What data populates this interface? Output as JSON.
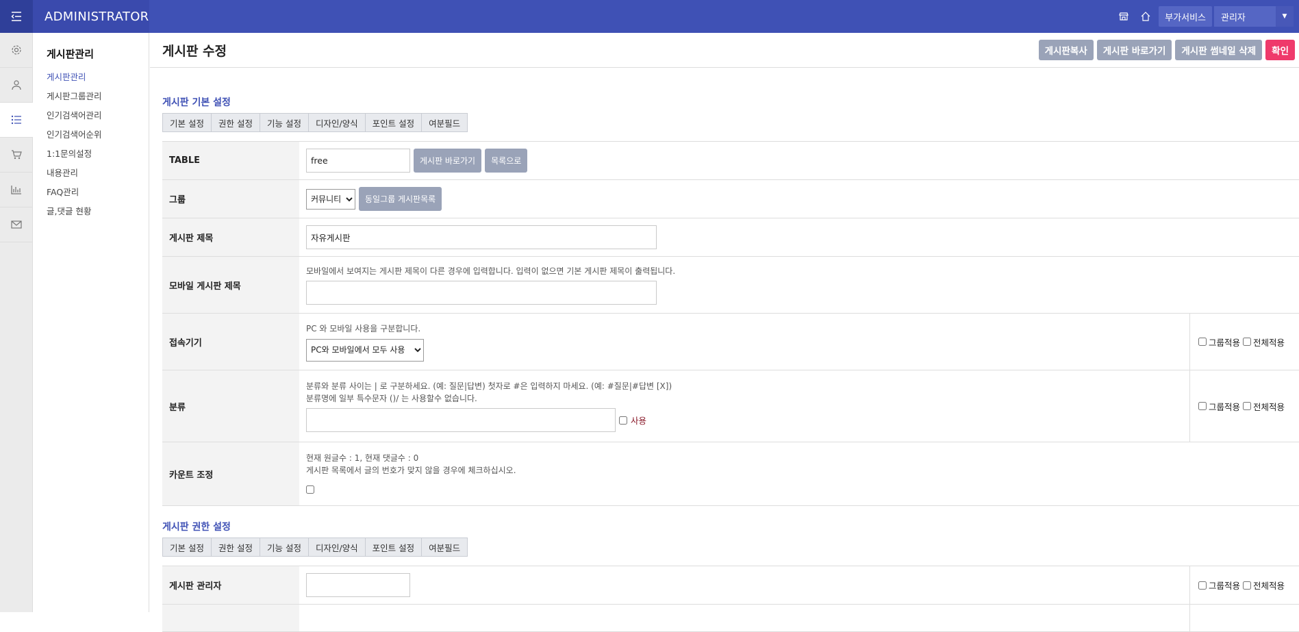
{
  "topbar": {
    "brand": "ADMINISTRATOR",
    "addon_label": "부가서비스",
    "admin_label": "관리자"
  },
  "subnav": {
    "title": "게시판관리",
    "items": [
      {
        "label": "게시판관리"
      },
      {
        "label": "게시판그룹관리"
      },
      {
        "label": "인기검색어관리"
      },
      {
        "label": "인기검색어순위"
      },
      {
        "label": "1:1문의설정"
      },
      {
        "label": "내용관리"
      },
      {
        "label": "FAQ관리"
      },
      {
        "label": "글,댓글 현황"
      }
    ]
  },
  "page": {
    "title": "게시판 수정",
    "buttons": {
      "copy": "게시판복사",
      "go": "게시판 바로가기",
      "thumb_delete": "게시판 썸네일 삭제",
      "confirm": "확인"
    }
  },
  "tabs": [
    "기본 설정",
    "권한 설정",
    "기능 설정",
    "디자인/양식",
    "포인트 설정",
    "여분필드"
  ],
  "basic": {
    "title": "게시판 기본 설정",
    "table_label": "TABLE",
    "table_value": "free",
    "table_go": "게시판 바로가기",
    "table_list": "목록으로",
    "group_label": "그룹",
    "group_value": "커뮤니티",
    "group_btn": "동일그룹 게시판목록",
    "subject_label": "게시판 제목",
    "subject_value": "자유게시판",
    "mobile_label": "모바일 게시판 제목",
    "mobile_help": "모바일에서 보여지는 게시판 제목이 다른 경우에 입력합니다. 입력이 없으면 기본 게시판 제목이 출력됩니다.",
    "device_label": "접속기기",
    "device_help": "PC 와 모바일 사용을 구분합니다.",
    "device_value": "PC와 모바일에서 모두 사용",
    "category_label": "분류",
    "category_help1": "분류와 분류 사이는 | 로 구분하세요. (예: 질문|답변) 첫자로 #은 입력하지 마세요. (예: #질문|#답변 [X])",
    "category_help2": "분류명에 일부 특수문자 ()/ 는 사용할수 없습니다.",
    "category_use": "사용",
    "count_label": "카운트 조정",
    "count_help1": "현재 원글수 : 1, 현재 댓글수 : 0",
    "count_help2": "게시판 목록에서 글의 번호가 맞지 않을 경우에 체크하십시오."
  },
  "perm": {
    "title": "게시판 권한 설정",
    "admin_label": "게시판 관리자"
  },
  "side": {
    "group_apply": "그룹적용",
    "all_apply": "전체적용"
  }
}
